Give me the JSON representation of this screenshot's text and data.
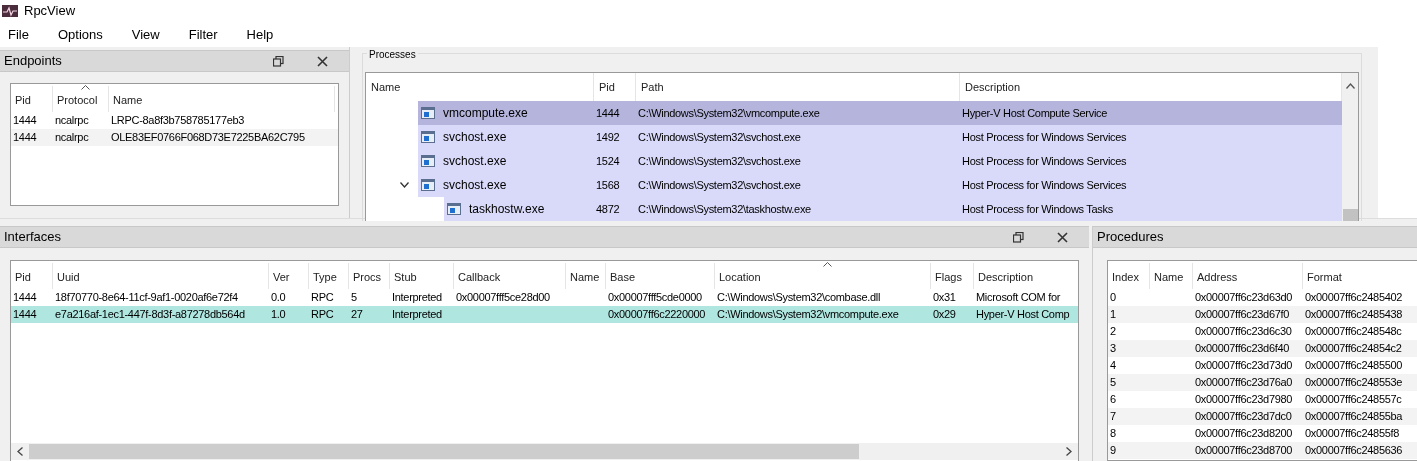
{
  "window": {
    "title": "RpcView"
  },
  "menu": [
    "File",
    "Options",
    "View",
    "Filter",
    "Help"
  ],
  "endpoints": {
    "title": "Endpoints",
    "columns": [
      {
        "label": "Pid",
        "sorted": false
      },
      {
        "label": "Protocol",
        "sorted": true
      },
      {
        "label": "Name",
        "sorted": false
      }
    ],
    "rows": [
      [
        "1444",
        "ncalrpc",
        "LRPC-8a8f3b758785177eb3"
      ],
      [
        "1444",
        "ncalrpc",
        "OLE83EF0766F068D73E7225BA62C795"
      ]
    ]
  },
  "processes": {
    "title": "Processes",
    "columns": [
      "Name",
      "Pid",
      "Path",
      "Description"
    ],
    "rows": [
      {
        "name": "vmcompute.exe",
        "pid": "1444",
        "path": "C:\\Windows\\System32\\vmcompute.exe",
        "description": "Hyper-V Host Compute Service",
        "selected": true
      },
      {
        "name": "svchost.exe",
        "pid": "1492",
        "path": "C:\\Windows\\System32\\svchost.exe",
        "description": "Host Process for Windows Services",
        "selected": false
      },
      {
        "name": "svchost.exe",
        "pid": "1524",
        "path": "C:\\Windows\\System32\\svchost.exe",
        "description": "Host Process for Windows Services",
        "selected": false
      },
      {
        "name": "svchost.exe",
        "pid": "1568",
        "path": "C:\\Windows\\System32\\svchost.exe",
        "description": "Host Process for Windows Services",
        "selected": false,
        "expanded": true,
        "children": [
          {
            "name": "taskhostw.exe",
            "pid": "4872",
            "path": "C:\\Windows\\System32\\taskhostw.exe",
            "description": "Host Process for Windows Tasks",
            "selected": false
          }
        ]
      }
    ]
  },
  "interfaces": {
    "title": "Interfaces",
    "columns": [
      {
        "label": "Pid",
        "sorted": false
      },
      {
        "label": "Uuid",
        "sorted": false
      },
      {
        "label": "Ver",
        "sorted": false
      },
      {
        "label": "Type",
        "sorted": false
      },
      {
        "label": "Procs",
        "sorted": false
      },
      {
        "label": "Stub",
        "sorted": false
      },
      {
        "label": "Callback",
        "sorted": false
      },
      {
        "label": "Name",
        "sorted": false
      },
      {
        "label": "Base",
        "sorted": false
      },
      {
        "label": "Location",
        "sorted": true
      },
      {
        "label": "Flags",
        "sorted": false
      },
      {
        "label": "Description",
        "sorted": false
      }
    ],
    "rows": [
      {
        "cells": [
          "1444",
          "18f70770-8e64-11cf-9af1-0020af6e72f4",
          "0.0",
          "RPC",
          "5",
          "Interpreted",
          "0x00007fff5ce28d00",
          "",
          "0x00007fff5cde0000",
          "C:\\Windows\\System32\\combase.dll",
          "0x31",
          "Microsoft COM for"
        ],
        "selected": false
      },
      {
        "cells": [
          "1444",
          "e7a216af-1ec1-447f-8d3f-a87278db564d",
          "1.0",
          "RPC",
          "27",
          "Interpreted",
          "",
          "",
          "0x00007ff6c2220000",
          "C:\\Windows\\System32\\vmcompute.exe",
          "0x29",
          "Hyper-V Host Comp"
        ],
        "selected": true
      }
    ]
  },
  "procedures": {
    "title": "Procedures",
    "columns": [
      "Index",
      "Name",
      "Address",
      "Format"
    ],
    "rows": [
      [
        "0",
        "",
        "0x00007ff6c23d63d0",
        "0x00007ff6c2485402"
      ],
      [
        "1",
        "",
        "0x00007ff6c23d67f0",
        "0x00007ff6c2485438"
      ],
      [
        "2",
        "",
        "0x00007ff6c23d6c30",
        "0x00007ff6c248548c"
      ],
      [
        "3",
        "",
        "0x00007ff6c23d6f40",
        "0x00007ff6c24854c2"
      ],
      [
        "4",
        "",
        "0x00007ff6c23d73d0",
        "0x00007ff6c2485500"
      ],
      [
        "5",
        "",
        "0x00007ff6c23d76a0",
        "0x00007ff6c248553e"
      ],
      [
        "6",
        "",
        "0x00007ff6c23d7980",
        "0x00007ff6c248557c"
      ],
      [
        "7",
        "",
        "0x00007ff6c23d7dc0",
        "0x00007ff6c24855ba"
      ],
      [
        "8",
        "",
        "0x00007ff6c23d8200",
        "0x00007ff6c24855f8"
      ],
      [
        "9",
        "",
        "0x00007ff6c23d8700",
        "0x00007ff6c2485636"
      ]
    ]
  }
}
